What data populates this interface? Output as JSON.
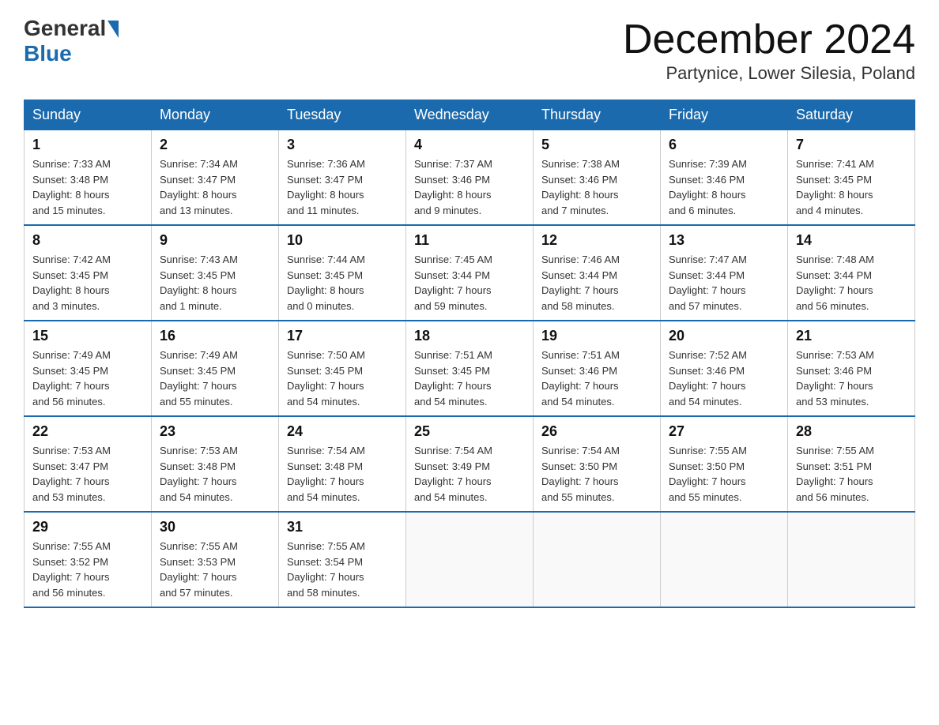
{
  "header": {
    "logo_general": "General",
    "logo_blue": "Blue",
    "month_title": "December 2024",
    "location": "Partynice, Lower Silesia, Poland"
  },
  "days_of_week": [
    "Sunday",
    "Monday",
    "Tuesday",
    "Wednesday",
    "Thursday",
    "Friday",
    "Saturday"
  ],
  "weeks": [
    [
      {
        "day": "1",
        "sunrise": "7:33 AM",
        "sunset": "3:48 PM",
        "daylight": "8 hours and 15 minutes."
      },
      {
        "day": "2",
        "sunrise": "7:34 AM",
        "sunset": "3:47 PM",
        "daylight": "8 hours and 13 minutes."
      },
      {
        "day": "3",
        "sunrise": "7:36 AM",
        "sunset": "3:47 PM",
        "daylight": "8 hours and 11 minutes."
      },
      {
        "day": "4",
        "sunrise": "7:37 AM",
        "sunset": "3:46 PM",
        "daylight": "8 hours and 9 minutes."
      },
      {
        "day": "5",
        "sunrise": "7:38 AM",
        "sunset": "3:46 PM",
        "daylight": "8 hours and 7 minutes."
      },
      {
        "day": "6",
        "sunrise": "7:39 AM",
        "sunset": "3:46 PM",
        "daylight": "8 hours and 6 minutes."
      },
      {
        "day": "7",
        "sunrise": "7:41 AM",
        "sunset": "3:45 PM",
        "daylight": "8 hours and 4 minutes."
      }
    ],
    [
      {
        "day": "8",
        "sunrise": "7:42 AM",
        "sunset": "3:45 PM",
        "daylight": "8 hours and 3 minutes."
      },
      {
        "day": "9",
        "sunrise": "7:43 AM",
        "sunset": "3:45 PM",
        "daylight": "8 hours and 1 minute."
      },
      {
        "day": "10",
        "sunrise": "7:44 AM",
        "sunset": "3:45 PM",
        "daylight": "8 hours and 0 minutes."
      },
      {
        "day": "11",
        "sunrise": "7:45 AM",
        "sunset": "3:44 PM",
        "daylight": "7 hours and 59 minutes."
      },
      {
        "day": "12",
        "sunrise": "7:46 AM",
        "sunset": "3:44 PM",
        "daylight": "7 hours and 58 minutes."
      },
      {
        "day": "13",
        "sunrise": "7:47 AM",
        "sunset": "3:44 PM",
        "daylight": "7 hours and 57 minutes."
      },
      {
        "day": "14",
        "sunrise": "7:48 AM",
        "sunset": "3:44 PM",
        "daylight": "7 hours and 56 minutes."
      }
    ],
    [
      {
        "day": "15",
        "sunrise": "7:49 AM",
        "sunset": "3:45 PM",
        "daylight": "7 hours and 56 minutes."
      },
      {
        "day": "16",
        "sunrise": "7:49 AM",
        "sunset": "3:45 PM",
        "daylight": "7 hours and 55 minutes."
      },
      {
        "day": "17",
        "sunrise": "7:50 AM",
        "sunset": "3:45 PM",
        "daylight": "7 hours and 54 minutes."
      },
      {
        "day": "18",
        "sunrise": "7:51 AM",
        "sunset": "3:45 PM",
        "daylight": "7 hours and 54 minutes."
      },
      {
        "day": "19",
        "sunrise": "7:51 AM",
        "sunset": "3:46 PM",
        "daylight": "7 hours and 54 minutes."
      },
      {
        "day": "20",
        "sunrise": "7:52 AM",
        "sunset": "3:46 PM",
        "daylight": "7 hours and 54 minutes."
      },
      {
        "day": "21",
        "sunrise": "7:53 AM",
        "sunset": "3:46 PM",
        "daylight": "7 hours and 53 minutes."
      }
    ],
    [
      {
        "day": "22",
        "sunrise": "7:53 AM",
        "sunset": "3:47 PM",
        "daylight": "7 hours and 53 minutes."
      },
      {
        "day": "23",
        "sunrise": "7:53 AM",
        "sunset": "3:48 PM",
        "daylight": "7 hours and 54 minutes."
      },
      {
        "day": "24",
        "sunrise": "7:54 AM",
        "sunset": "3:48 PM",
        "daylight": "7 hours and 54 minutes."
      },
      {
        "day": "25",
        "sunrise": "7:54 AM",
        "sunset": "3:49 PM",
        "daylight": "7 hours and 54 minutes."
      },
      {
        "day": "26",
        "sunrise": "7:54 AM",
        "sunset": "3:50 PM",
        "daylight": "7 hours and 55 minutes."
      },
      {
        "day": "27",
        "sunrise": "7:55 AM",
        "sunset": "3:50 PM",
        "daylight": "7 hours and 55 minutes."
      },
      {
        "day": "28",
        "sunrise": "7:55 AM",
        "sunset": "3:51 PM",
        "daylight": "7 hours and 56 minutes."
      }
    ],
    [
      {
        "day": "29",
        "sunrise": "7:55 AM",
        "sunset": "3:52 PM",
        "daylight": "7 hours and 56 minutes."
      },
      {
        "day": "30",
        "sunrise": "7:55 AM",
        "sunset": "3:53 PM",
        "daylight": "7 hours and 57 minutes."
      },
      {
        "day": "31",
        "sunrise": "7:55 AM",
        "sunset": "3:54 PM",
        "daylight": "7 hours and 58 minutes."
      },
      null,
      null,
      null,
      null
    ]
  ],
  "labels": {
    "sunrise": "Sunrise:",
    "sunset": "Sunset:",
    "daylight": "Daylight:"
  }
}
